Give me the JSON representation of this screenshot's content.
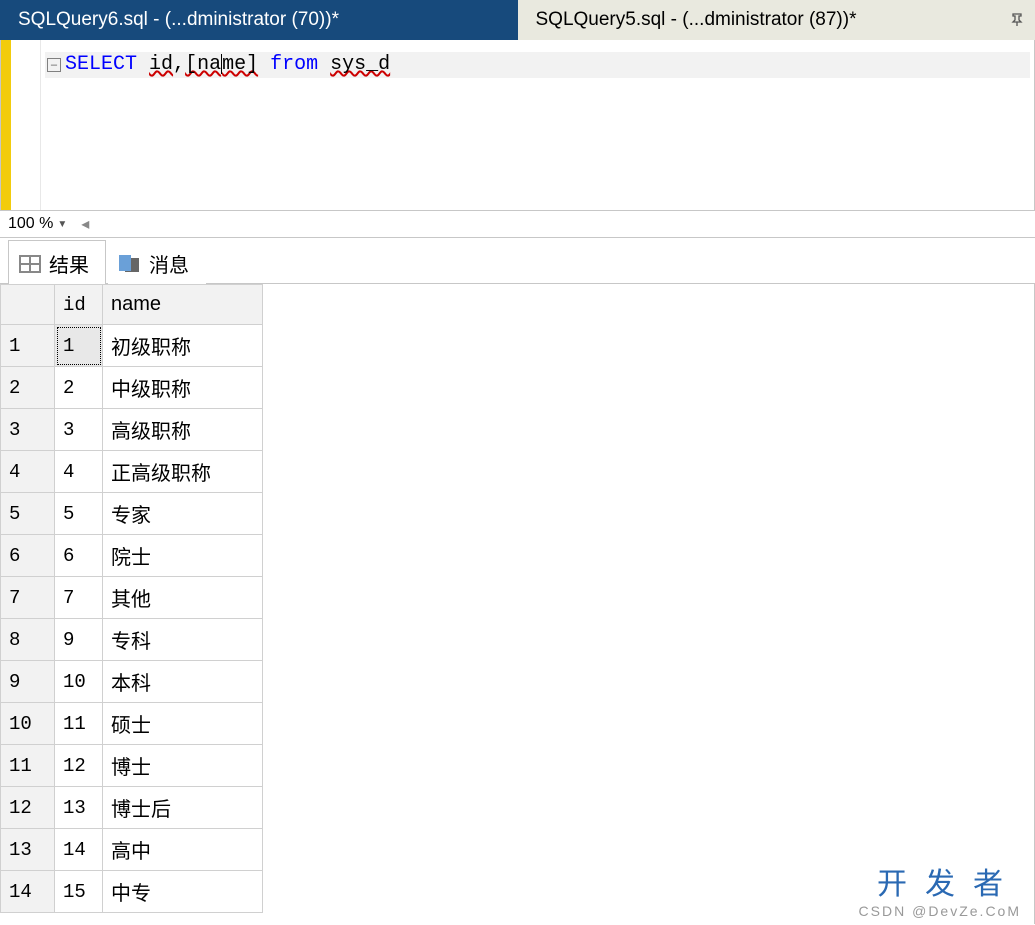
{
  "tabs": [
    {
      "label": "SQLQuery6.sql - (...dministrator (70))*",
      "active": true
    },
    {
      "label": "SQLQuery5.sql - (...dministrator (87))*",
      "active": false
    }
  ],
  "editor": {
    "fold_glyph": "−",
    "tokens": {
      "kw_select": "SELECT",
      "id_token": "id",
      "comma": ",",
      "name_token": "[name]",
      "kw_from": "from",
      "table_token": "sys_d"
    }
  },
  "zoom": {
    "value": "100 %"
  },
  "result_tabs": {
    "results_label": "结果",
    "messages_label": "消息"
  },
  "results": {
    "headers": {
      "rownum": "",
      "id": "id",
      "name": "name"
    },
    "rows": [
      {
        "rownum": "1",
        "id": "1",
        "name": "初级职称",
        "selected": true
      },
      {
        "rownum": "2",
        "id": "2",
        "name": "中级职称"
      },
      {
        "rownum": "3",
        "id": "3",
        "name": "高级职称"
      },
      {
        "rownum": "4",
        "id": "4",
        "name": "正高级职称"
      },
      {
        "rownum": "5",
        "id": "5",
        "name": "专家"
      },
      {
        "rownum": "6",
        "id": "6",
        "name": "院士"
      },
      {
        "rownum": "7",
        "id": "7",
        "name": "其他"
      },
      {
        "rownum": "8",
        "id": "9",
        "name": "专科"
      },
      {
        "rownum": "9",
        "id": "10",
        "name": "本科"
      },
      {
        "rownum": "10",
        "id": "11",
        "name": "硕士"
      },
      {
        "rownum": "11",
        "id": "12",
        "name": "博士"
      },
      {
        "rownum": "12",
        "id": "13",
        "name": "博士后"
      },
      {
        "rownum": "13",
        "id": "14",
        "name": "高中"
      },
      {
        "rownum": "14",
        "id": "15",
        "name": "中专"
      }
    ]
  },
  "watermark": {
    "big": "开发者",
    "small": "CSDN @DevZe.CoM"
  }
}
